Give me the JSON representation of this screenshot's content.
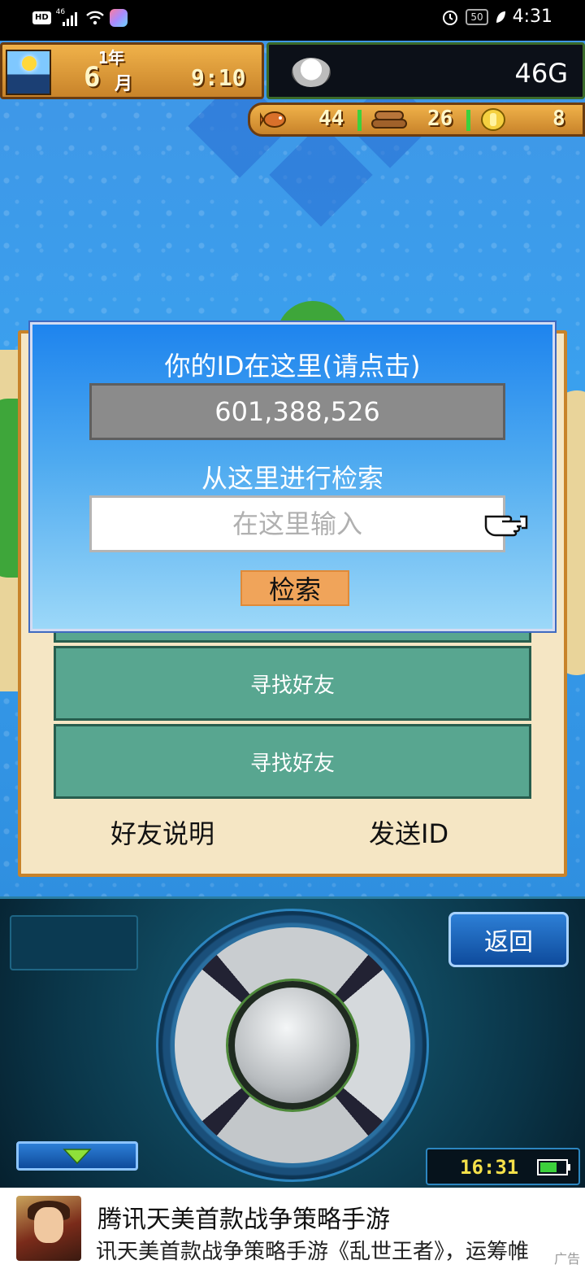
{
  "status_bar": {
    "hd": "HD",
    "network": "46",
    "battery": "50",
    "time": "4:31"
  },
  "hud": {
    "year": "1年",
    "month_num": "6",
    "month_unit": "月",
    "time": "9:10",
    "gold": "46G",
    "resources": [
      {
        "icon": "fish-icon",
        "value": "44"
      },
      {
        "icon": "wood-icon",
        "value": "26"
      },
      {
        "icon": "coin-icon",
        "value": "8"
      }
    ]
  },
  "dialog": {
    "title": "你的ID在这里(请点击)",
    "id_value": "601,388,526",
    "subtitle": "从这里进行检索",
    "search_placeholder": "在这里输入",
    "search_button": "检索"
  },
  "panel": {
    "find_buttons": [
      "寻找好友",
      "寻找好友"
    ],
    "friend_info": "好友说明",
    "send_id": "发送ID"
  },
  "controller": {
    "back": "返回",
    "clock": "16:31"
  },
  "ad": {
    "title": "腾讯天美首款战争策略手游",
    "desc": "讯天美首款战争策略手游《乱世王者》，运筹帷",
    "tag": "广告"
  }
}
